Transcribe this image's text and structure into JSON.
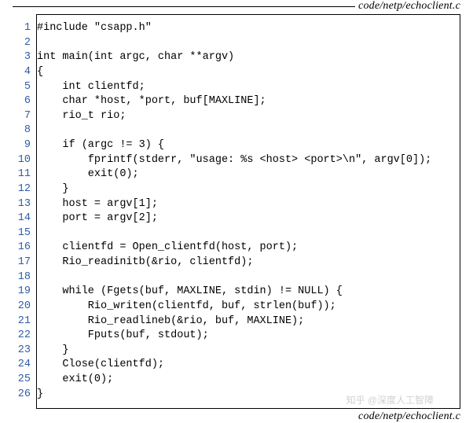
{
  "header_path": "code/netp/echoclient.c",
  "footer_path": "code/netp/echoclient.c",
  "watermark": "知乎 @深度人工智障",
  "code_lines": [
    "#include \"csapp.h\"",
    "",
    "int main(int argc, char **argv)",
    "{",
    "    int clientfd;",
    "    char *host, *port, buf[MAXLINE];",
    "    rio_t rio;",
    "",
    "    if (argc != 3) {",
    "        fprintf(stderr, \"usage: %s <host> <port>\\n\", argv[0]);",
    "        exit(0);",
    "    }",
    "    host = argv[1];",
    "    port = argv[2];",
    "",
    "    clientfd = Open_clientfd(host, port);",
    "    Rio_readinitb(&rio, clientfd);",
    "",
    "    while (Fgets(buf, MAXLINE, stdin) != NULL) {",
    "        Rio_writen(clientfd, buf, strlen(buf));",
    "        Rio_readlineb(&rio, buf, MAXLINE);",
    "        Fputs(buf, stdout);",
    "    }",
    "    Close(clientfd);",
    "    exit(0);",
    "}"
  ]
}
